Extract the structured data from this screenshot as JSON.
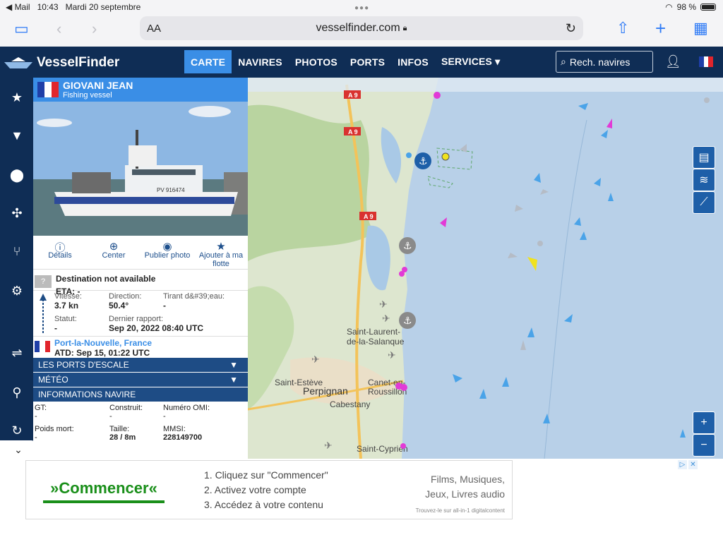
{
  "status": {
    "app_back": "◀ Mail",
    "time": "10:43",
    "date": "Mardi 20 septembre",
    "battery": "98 %"
  },
  "browser": {
    "url": "vesselfinder.com",
    "aa": "AA"
  },
  "nav": {
    "brand": "VesselFinder",
    "items": [
      "CARTE",
      "NAVIRES",
      "PHOTOS",
      "PORTS",
      "INFOS",
      "SERVICES ▾"
    ],
    "search_placeholder": "Rech. navires"
  },
  "vessel": {
    "name": "GIOVANI JEAN",
    "type": "Fishing vessel",
    "hull_mark": "PV 916474",
    "actions": [
      "Détails",
      "Center",
      "Publier photo",
      "Ajouter à ma flotte"
    ],
    "destination": "Destination not available",
    "eta": "ETA: -",
    "unknown": "?",
    "speed_label": "Vitesse:",
    "speed": "3.7 kn",
    "course_label": "Direction:",
    "course": "50.4°",
    "draught_label": "Tirant d&#39;eau:",
    "draught": "-",
    "status_label": "Statut:",
    "status": "-",
    "report_label": "Dernier rapport:",
    "report": "Sep 20, 2022 08:40 UTC",
    "port": "Port-la-Nouvelle, France",
    "atd": "ATD: Sep 15, 01:22 UTC",
    "sections": [
      "LES PORTS D'ESCALE",
      "MÉTÉO",
      "INFORMATIONS NAVIRE"
    ],
    "gt_label": "GT:",
    "gt": "-",
    "built_label": "Construit:",
    "built": "-",
    "imo_label": "Numéro OMI:",
    "imo": "-",
    "dwt_label": "Poids mort:",
    "dwt": "-",
    "size_label": "Taille:",
    "size": "28 / 8m",
    "mmsi_label": "MMSI:",
    "mmsi": "228149700"
  },
  "map": {
    "labels": [
      "Saint-Laurent-",
      "de-la-Salanque",
      "Saint-Estève",
      "Perpignan",
      "Canet-en-",
      "Roussillon",
      "Cabestany",
      "Saint-Cyprien"
    ],
    "roads": [
      "A 9",
      "A 9",
      "A 9"
    ],
    "zoom_in": "+",
    "zoom_out": "−"
  },
  "ad": {
    "button": "»Commencer«",
    "steps": [
      "1. Cliquez sur \"Commencer\"",
      "2. Activez votre compte",
      "3. Accédez à votre contenu"
    ],
    "right": [
      "Films, Musiques,",
      "Jeux, Livres audio"
    ],
    "tiny": "Trouvez-le sur all-in-1 digitalcontent"
  }
}
